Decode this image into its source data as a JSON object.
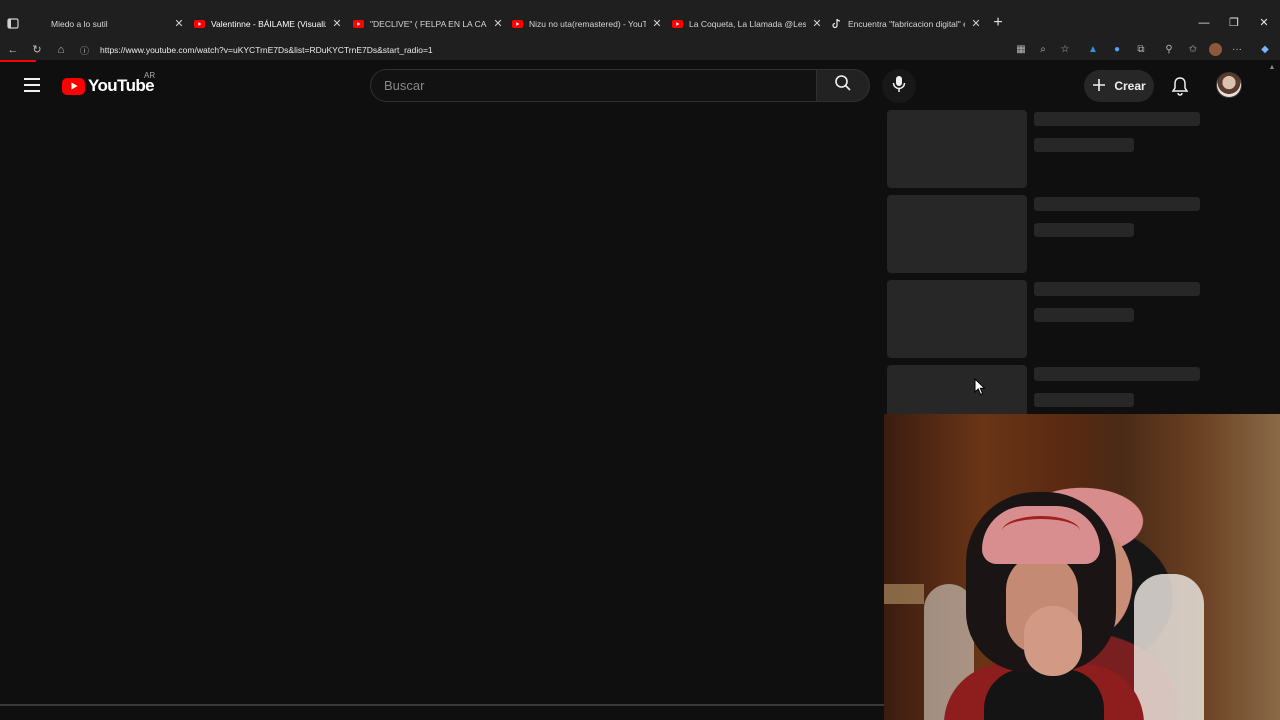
{
  "browser": {
    "tabs": [
      {
        "title": "Miedo a lo sutil",
        "favicon": "generic-page-icon",
        "active": false
      },
      {
        "title": "Valentinne - BÁILAME (Visualizer)",
        "favicon": "youtube-icon",
        "active": true
      },
      {
        "title": "\"DECLIVE\" ( FELPA EN LA CASA, e",
        "favicon": "youtube-icon",
        "active": false
      },
      {
        "title": "Nizu no uta(remastered) - YouTu",
        "favicon": "youtube-icon",
        "active": false
      },
      {
        "title": "La Coqueta, La Llamada @LeslieR",
        "favicon": "youtube-icon",
        "active": false
      },
      {
        "title": "Encuentra \"fabricacion digital\" en",
        "favicon": "tiktok-icon",
        "active": false
      }
    ],
    "url": "https://www.youtube.com/watch?v=uKYCTrnE7Ds&list=RDuKYCTrnE7Ds&start_radio=1"
  },
  "youtube": {
    "logo_text": "YouTube",
    "country_code": "AR",
    "search": {
      "placeholder": "Buscar"
    },
    "create_label": "Crear",
    "accent_color": "#ff0000",
    "skeleton_rows": 4
  }
}
